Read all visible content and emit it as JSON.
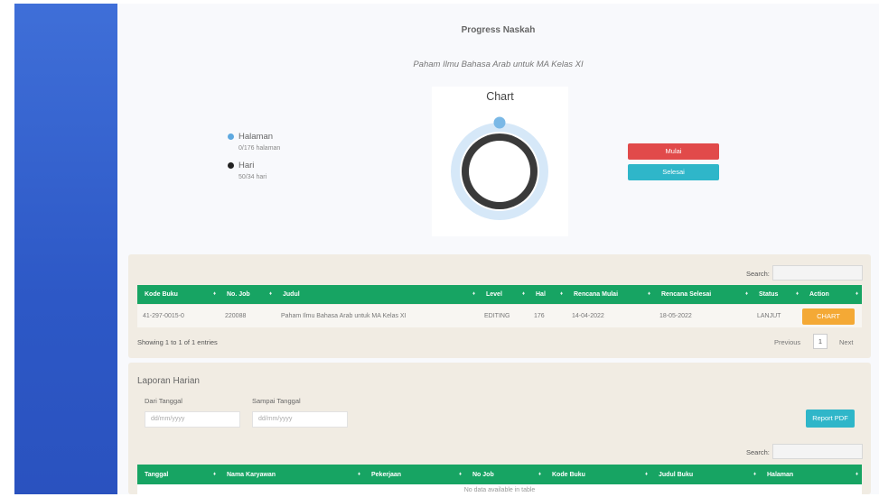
{
  "page": {
    "title": "Progress Naskah",
    "book_title": "Paham Ilmu Bahasa Arab untuk MA Kelas XI"
  },
  "legend": {
    "items": [
      {
        "label": "Halaman",
        "sub": "0/176 halaman",
        "color": "#5ea9e0"
      },
      {
        "label": "Hari",
        "sub": "50/34 hari",
        "color": "#222222"
      }
    ]
  },
  "chart": {
    "title": "Chart",
    "outer_color": "#d6e8f8",
    "inner_color": "#3a3a3a",
    "marker_color": "#7ab8e6"
  },
  "chart_data": {
    "type": "pie",
    "title": "Chart",
    "series": [
      {
        "name": "Halaman",
        "value": 0,
        "total": 176
      },
      {
        "name": "Hari",
        "value": 50,
        "total": 34
      }
    ]
  },
  "actions": {
    "mulai": "Mulai",
    "selesai": "Selesai"
  },
  "progress_table": {
    "search_label": "Search:",
    "columns": [
      "Kode Buku",
      "No. Job",
      "Judul",
      "Level",
      "Hal",
      "Rencana Mulai",
      "Rencana Selesai",
      "Status",
      "Action"
    ],
    "rows": [
      {
        "kode_buku": "41-297-0015-0",
        "no_job": "220088",
        "judul": "Paham Ilmu Bahasa Arab untuk MA Kelas XI",
        "level": "EDITING",
        "hal": "176",
        "rencana_mulai": "14-04-2022",
        "rencana_selesai": "18-05-2022",
        "status": "LANJUT",
        "action": "CHART"
      }
    ],
    "info": "Showing 1 to 1 of 1 entries",
    "previous": "Previous",
    "page": "1",
    "next": "Next"
  },
  "laporan": {
    "title": "Laporan Harian",
    "dari_label": "Dari Tanggal",
    "sampai_label": "Sampai Tanggal",
    "dari_placeholder": "dd/mm/yyyy",
    "sampai_placeholder": "dd/mm/yyyy",
    "report_button": "Report PDF",
    "search_label": "Search:",
    "columns": [
      "Tanggal",
      "Nama Karyawan",
      "Pekerjaan",
      "No Job",
      "Kode Buku",
      "Judul Buku",
      "Halaman"
    ],
    "empty": "No data available in table"
  },
  "colors": {
    "sidebar": "#3465d3",
    "table_header": "#17a463",
    "mulai": "#e14a4a",
    "selesai": "#2fb6c9",
    "chart_button": "#f4a935"
  }
}
